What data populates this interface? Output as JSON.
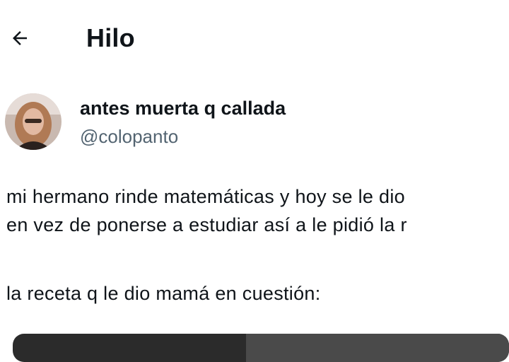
{
  "header": {
    "back_icon": "arrow-left-icon",
    "title": "Hilo"
  },
  "tweet": {
    "author": {
      "display_name": "antes muerta q callada",
      "handle": "@colopanto",
      "avatar_icon": "avatar-photo"
    },
    "text_lines": [
      "mi hermano rinde matemáticas y hoy se le dio",
      "en vez de ponerse a estudiar así a le pidió la r",
      "la receta q le dio mamá en cuestión:"
    ]
  },
  "colors": {
    "text_primary": "#0f1419",
    "text_secondary": "#536471",
    "background": "#ffffff"
  }
}
